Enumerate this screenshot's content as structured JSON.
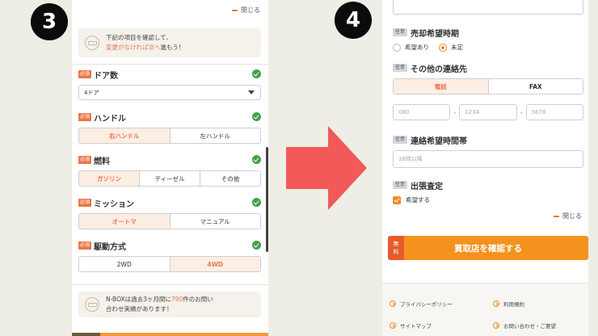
{
  "steps": {
    "left": "3",
    "right": "4"
  },
  "left": {
    "close_label": "閉じる",
    "notice": {
      "line1": "下記の項目を確認して、",
      "line2_orange": "変更がなければ次へ",
      "line2_rest": "進もう！"
    },
    "required_tag": "必須",
    "door": {
      "title": "ドア数",
      "value": "4ドア"
    },
    "handle": {
      "title": "ハンドル",
      "options": [
        "右ハンドル",
        "左ハンドル"
      ],
      "selected": 0
    },
    "fuel": {
      "title": "燃料",
      "options": [
        "ガソリン",
        "ディーゼル",
        "その他"
      ],
      "selected": 0
    },
    "mission": {
      "title": "ミッション",
      "options": [
        "オートマ",
        "マニュアル"
      ],
      "selected": 0
    },
    "drive": {
      "title": "駆動方式",
      "options": [
        "2WD",
        "4WD"
      ],
      "selected": 1
    },
    "footer": {
      "part1": "N-BOXは過去3ヶ月間に",
      "count": "790",
      "part2": "件のお問い",
      "line2": "合わせ実績があります！"
    }
  },
  "right": {
    "optional_tag": "任意",
    "sell_timing": {
      "title": "売却希望時期",
      "options": [
        "希望あり",
        "未定"
      ],
      "selected": 1
    },
    "contact": {
      "title": "その他の連絡先",
      "options": [
        "電話",
        "FAX"
      ],
      "selected": 0,
      "phone_placeholders": [
        "080",
        "1234",
        "5678"
      ]
    },
    "contact_time": {
      "title": "連絡希望時間帯",
      "placeholder": "18時以降"
    },
    "visit": {
      "title": "出張査定",
      "checkbox_label": "希望する"
    },
    "close_label": "閉じる",
    "cta": {
      "free_line1": "無",
      "free_line2": "料",
      "label": "買取店を確認する"
    },
    "links": [
      "プライバシーポリシー",
      "利用規約",
      "サイトマップ",
      "お問い合わせ・ご要望"
    ]
  },
  "colors": {
    "accent": "#e8774a",
    "cta": "#f5921e",
    "arrow": "#f25a5a",
    "check": "#43a047"
  }
}
